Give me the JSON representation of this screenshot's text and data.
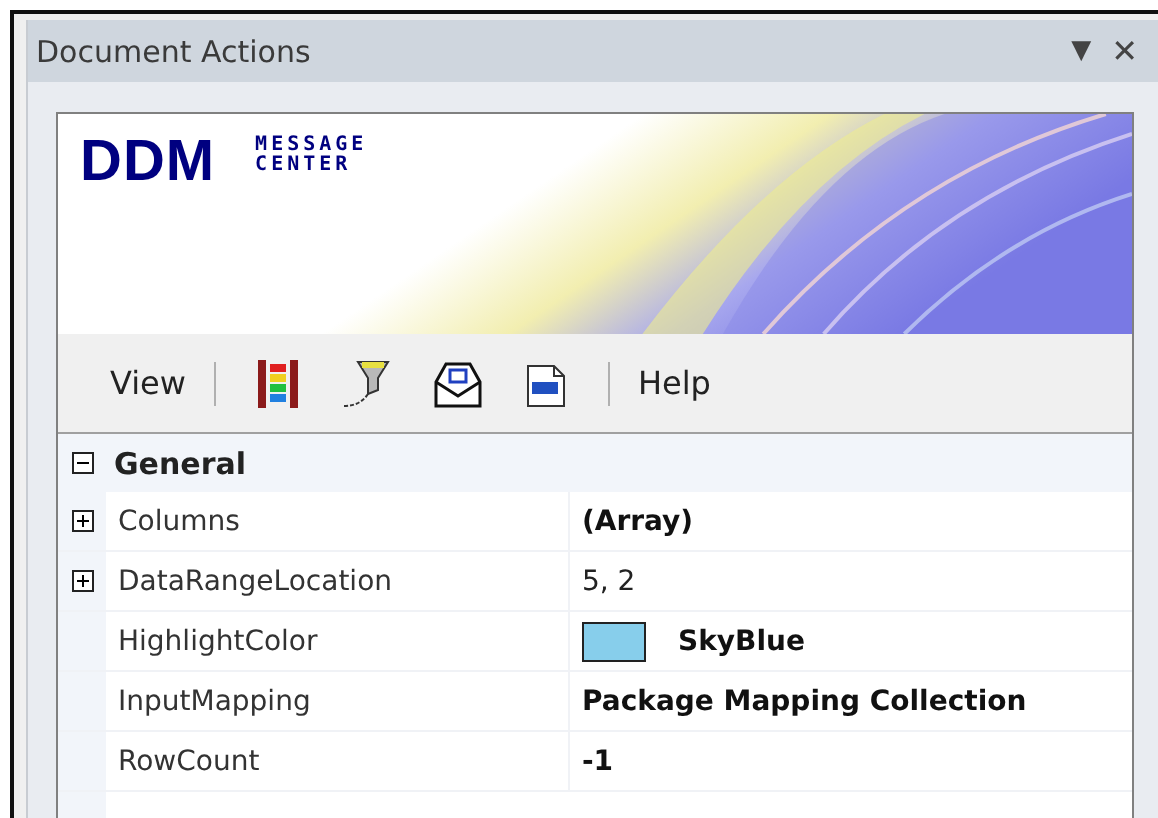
{
  "pane": {
    "title": "Document Actions",
    "menu_glyph": "▼",
    "close_glyph": "✕"
  },
  "banner": {
    "logo": "DDM",
    "subtitle_1": "MESSAGE",
    "subtitle_2": "CENTER"
  },
  "toolbar": [
    {
      "kind": "text",
      "label": "View"
    },
    {
      "kind": "separator"
    },
    {
      "kind": "icon"
    },
    {
      "kind": "icon"
    },
    {
      "kind": "icon"
    },
    {
      "kind": "icon"
    },
    {
      "kind": "separator"
    },
    {
      "kind": "text",
      "label": "Help"
    }
  ],
  "property_grid": {
    "category": {
      "label": "General",
      "expanded": true
    },
    "rows": [
      {
        "name": "Columns",
        "value": "(Array)",
        "expanded": false,
        "bold": true
      },
      {
        "name": "DataRangeLocation",
        "value": "5, 2",
        "expanded": false,
        "bold": false
      },
      {
        "name": "HighlightColor",
        "value": "SkyBlue",
        "bold": true,
        "color": "#87ceeb"
      },
      {
        "name": "InputMapping",
        "value": "Package Mapping Collection",
        "bold": true
      },
      {
        "name": "RowCount",
        "value": "-1",
        "bold": true
      }
    ]
  }
}
